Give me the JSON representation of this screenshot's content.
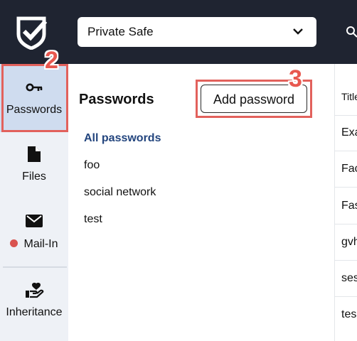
{
  "topbar": {
    "logo_icon": "shield-check-icon",
    "safe_select": {
      "value": "Private Safe",
      "icon": "chevron-down-icon"
    },
    "search_icon": "search-icon"
  },
  "sidebar": {
    "items": [
      {
        "label": "Passwords",
        "icon": "key-icon",
        "active": true
      },
      {
        "label": "Files",
        "icon": "file-icon"
      },
      {
        "label": "Mail-In",
        "icon": "envelope-icon",
        "status_color": "#d9534f"
      },
      {
        "label": "Inheritance",
        "icon": "heart-hand-icon"
      }
    ]
  },
  "annotations": {
    "step_2": "2",
    "step_3": "3",
    "highlight_color": "#e2615c"
  },
  "main": {
    "heading": "Passwords",
    "add_button": "Add password",
    "folders": [
      {
        "label": "All passwords",
        "active": true
      },
      {
        "label": "foo"
      },
      {
        "label": "social network"
      },
      {
        "label": "test"
      }
    ]
  },
  "table": {
    "column_title": "Title",
    "rows": [
      "Exa",
      "Fac",
      "Fas",
      "gvh",
      "ses",
      "tes"
    ]
  },
  "colors": {
    "topbar": "#1f2431",
    "sidebar": "#eef1f6",
    "sidebar_active": "#cfdcef",
    "link": "#23457e"
  }
}
